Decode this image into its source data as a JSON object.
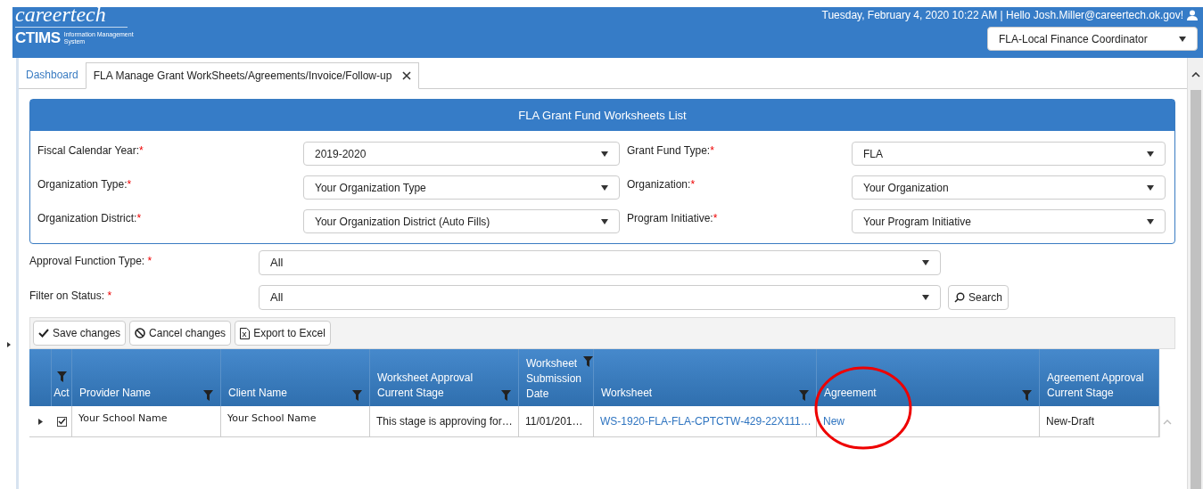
{
  "header": {
    "logo": {
      "brand": "careertech",
      "acronym": "CTIMS",
      "subtitle_1": "Information Management",
      "subtitle_2": "System"
    },
    "greeting": "Tuesday, February 4, 2020 10:22 AM | Hello Josh.Miller@careertech.ok.gov!",
    "role_select": "FLA-Local Finance Coordinator"
  },
  "tabs": [
    {
      "label": "Dashboard",
      "selected": false,
      "closable": false
    },
    {
      "label": "FLA Manage Grant WorkSheets/Agreements/Invoice/Follow-up",
      "selected": true,
      "closable": true
    }
  ],
  "panel": {
    "title": "FLA Grant Fund Worksheets List",
    "fields": [
      {
        "label": "Fiscal Calendar Year:",
        "required_mark": "*",
        "value": "2019-2020"
      },
      {
        "label": "Grant Fund Type:",
        "required_mark": "*",
        "value": "FLA"
      },
      {
        "label": "Organization Type:",
        "required_mark": "*",
        "value": "Your Organization Type"
      },
      {
        "label": "Organization:",
        "required_mark": "*",
        "value": "Your Organization"
      },
      {
        "label": "Organization District:",
        "required_mark": "*",
        "value": "Your Organization District (Auto Fills)"
      },
      {
        "label": "Program Initiative:",
        "required_mark": "*",
        "value": "Your Program Initiative"
      }
    ]
  },
  "filters": [
    {
      "label": "Approval Function Type: ",
      "required_mark": "*",
      "value": "All"
    },
    {
      "label": "Filter on Status: ",
      "required_mark": "*",
      "value": "All"
    }
  ],
  "search_button": "Search",
  "toolbar": [
    {
      "kind": "save",
      "label": "Save changes"
    },
    {
      "kind": "cancel",
      "label": "Cancel changes"
    },
    {
      "kind": "excel",
      "label": "Export to Excel"
    }
  ],
  "grid": {
    "columns": [
      {
        "label": "Act",
        "filter": true
      },
      {
        "label": "Provider Name",
        "filter": true
      },
      {
        "label": "Client Name",
        "filter": true
      },
      {
        "label": "Worksheet Approval Current Stage",
        "filter": true
      },
      {
        "label": "Worksheet Submission Date",
        "filter": true
      },
      {
        "label": "Worksheet",
        "filter": true
      },
      {
        "label": "Agreement",
        "filter": true
      },
      {
        "label": "Agreement Approval Current Stage",
        "filter": false
      }
    ],
    "rows": [
      {
        "expanded": false,
        "checked": true,
        "provider": "Your School Name",
        "client": "Your School Name",
        "stage": "This stage is approving for…",
        "date": "11/01/201…",
        "worksheet": "WS-1920-FLA-FLA-CPTCTW-429-22X111…",
        "agreement": "New",
        "agreement_stage": "New-Draft"
      }
    ]
  },
  "annotation": {
    "kind": "ellipse"
  }
}
